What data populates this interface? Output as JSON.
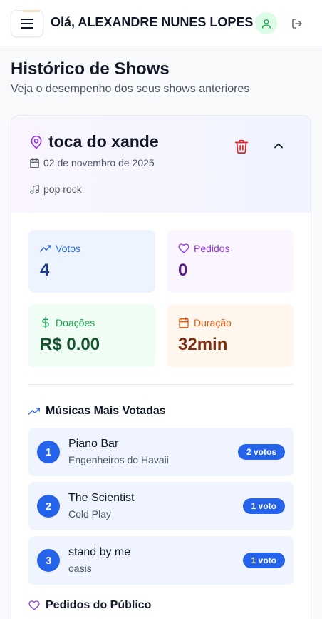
{
  "header": {
    "greeting": "Olá, ALEXANDRE NUNES LOPES",
    "menu_icon": "menu-icon",
    "avatar_icon": "user-icon",
    "logout_icon": "logout-icon",
    "avatar_color": "#16a34a"
  },
  "page": {
    "title": "Histórico de Shows",
    "subtitle": "Veja o desempenho dos seus shows anteriores"
  },
  "show": {
    "name": "toca do xande",
    "date": "02 de novembro de 2025",
    "genre": "pop rock",
    "stats": {
      "votes": {
        "label": "Votos",
        "value": "4"
      },
      "requests": {
        "label": "Pedidos",
        "value": "0"
      },
      "donations": {
        "label": "Doações",
        "value": "R$ 0.00"
      },
      "duration": {
        "label": "Duração",
        "value": "32min"
      }
    },
    "top_songs_title": "Músicas Mais Votadas",
    "top_songs": [
      {
        "rank": "1",
        "title": "Piano Bar",
        "artist": "Engenheiros do Havaii",
        "votes": "2 votos"
      },
      {
        "rank": "2",
        "title": "The Scientist",
        "artist": "Cold Play",
        "votes": "1 voto"
      },
      {
        "rank": "3",
        "title": "stand by me",
        "artist": "oasis",
        "votes": "1 voto"
      }
    ],
    "requests_title": "Pedidos do Público"
  },
  "colors": {
    "accent_blue": "#2563eb",
    "accent_purple": "#9333ea",
    "accent_green": "#16a34a",
    "accent_orange": "#ea580c",
    "delete_red": "#dc2626"
  }
}
